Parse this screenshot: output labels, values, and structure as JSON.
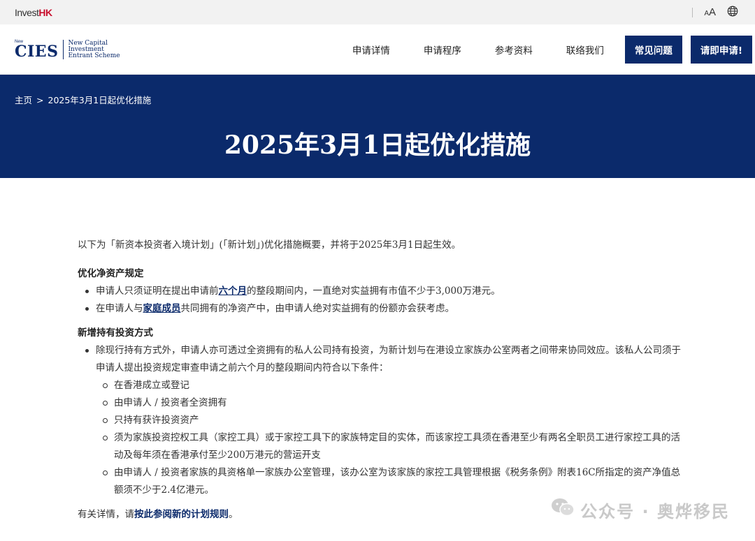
{
  "topbar": {
    "brand_prefix": "Invest",
    "brand_suffix": "HK",
    "font_small": "A",
    "font_big": "A",
    "language_icon": "globe-icon"
  },
  "header": {
    "logo_new": "New",
    "logo_cies": "CIES",
    "logo_line1": "New Capital",
    "logo_line2": "Investment",
    "logo_line3": "Entrant Scheme",
    "nav": [
      "申请详情",
      "申请程序",
      "参考资料",
      "联络我们"
    ],
    "faq_button": "常见问题",
    "apply_button": "请即申请!"
  },
  "hero": {
    "breadcrumb_home": "主页",
    "breadcrumb_sep": ">",
    "breadcrumb_current": "2025年3月1日起优化措施",
    "title": "2025年3月1日起优化措施"
  },
  "content": {
    "intro": "以下为「新资本投资者入境计划」(「新计划」)优化措施概要，并将于2025年3月1日起生效。",
    "section1": {
      "title": "优化净资产规定",
      "item1_pre": "申请人只须证明在提出申请前",
      "item1_link": "六个月",
      "item1_post": "的整段期间内，一直绝对实益拥有市值不少于3,000万港元。",
      "item2_pre": "在申请人与",
      "item2_link": "家庭成员",
      "item2_post": "共同拥有的净资产中，由申请人绝对实益拥有的份额亦会获考虑。"
    },
    "section2": {
      "title": "新增持有投资方式",
      "item1": "除现行持有方式外，申请人亦可透过全资拥有的私人公司持有投资，为新计划与在港设立家族办公室两者之间带来协同效应。该私人公司须于申请人提出投资规定审查申请之前六个月的整段期间内符合以下条件：",
      "sub": [
        "在香港成立或登记",
        "由申请人 / 投资者全资拥有",
        "只持有获许投资资产",
        "须为家族投资控权工具（家控工具）或于家控工具下的家族特定目的实体，而该家控工具须在香港至少有两名全职员工进行家控工具的活动及每年须在香港承付至少200万港元的营运开支",
        "由申请人 / 投资者家族的具资格单一家族办公室管理，该办公室为该家族的家控工具管理根据《税务条例》附表16C所指定的资产净值总额须不少于2.4亿港元。"
      ]
    },
    "footer_pre": "有关详情，请",
    "footer_link": "按此参阅新的计划规则",
    "footer_post": "。"
  },
  "watermark": {
    "text": "公众号 · 奥烨移民",
    "icon": "wechat-icon"
  }
}
